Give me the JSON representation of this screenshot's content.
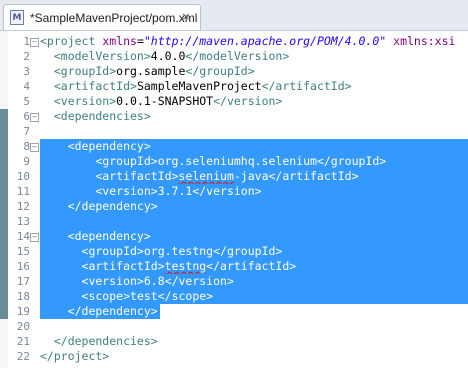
{
  "tab": {
    "title": "*SampleMavenProject/pom.xml",
    "icon": "maven-file-icon",
    "close": "×"
  },
  "colors": {
    "selection": "#3399ff",
    "tag": "#3f7f7f",
    "attr": "#7f007f",
    "string": "#2a00ff",
    "line_number": "#7a8899"
  },
  "editor": {
    "line_numbers": [
      "1",
      "2",
      "3",
      "4",
      "5",
      "6",
      "7",
      "8",
      "9",
      "10",
      "11",
      "12",
      "13",
      "14",
      "15",
      "16",
      "17",
      "18",
      "19",
      "20",
      "21",
      "22"
    ],
    "lines": [
      {
        "parts": [
          {
            "t": "<project ",
            "c": "tag"
          },
          {
            "t": "xmlns",
            "c": "attr"
          },
          {
            "t": "=",
            "c": "txt"
          },
          {
            "t": "\"http://maven.apache.org/POM/4.0.0\"",
            "c": "str"
          },
          {
            "t": " ",
            "c": "txt"
          },
          {
            "t": "xmlns:xsi",
            "c": "attr"
          }
        ]
      },
      {
        "parts": [
          {
            "t": "  <modelVersion>",
            "c": "tag"
          },
          {
            "t": "4.0.0",
            "c": "txt"
          },
          {
            "t": "</modelVersion>",
            "c": "tag"
          }
        ]
      },
      {
        "parts": [
          {
            "t": "  <groupId>",
            "c": "tag"
          },
          {
            "t": "org.sample",
            "c": "txt"
          },
          {
            "t": "</groupId>",
            "c": "tag"
          }
        ]
      },
      {
        "parts": [
          {
            "t": "  <artifactId>",
            "c": "tag"
          },
          {
            "t": "SampleMavenProject",
            "c": "txt"
          },
          {
            "t": "</artifactId>",
            "c": "tag"
          }
        ]
      },
      {
        "parts": [
          {
            "t": "  <version>",
            "c": "tag"
          },
          {
            "t": "0.0.1-SNAPSHOT",
            "c": "txt"
          },
          {
            "t": "</version>",
            "c": "tag"
          }
        ]
      },
      {
        "parts": [
          {
            "t": "  <dependencies>",
            "c": "tag"
          }
        ]
      },
      {
        "parts": [
          {
            "t": "",
            "c": "txt"
          }
        ]
      },
      {
        "parts": [
          {
            "t": "    <dependency>",
            "c": "tag"
          }
        ]
      },
      {
        "parts": [
          {
            "t": "        <groupId>",
            "c": "tag"
          },
          {
            "t": "org.seleniumhq.selenium",
            "c": "txt"
          },
          {
            "t": "</groupId>",
            "c": "tag"
          }
        ]
      },
      {
        "parts": [
          {
            "t": "        <artifactId>",
            "c": "tag"
          },
          {
            "t": "selenium",
            "c": "txt",
            "spell": true
          },
          {
            "t": "-java",
            "c": "txt"
          },
          {
            "t": "</artifactId>",
            "c": "tag"
          }
        ]
      },
      {
        "parts": [
          {
            "t": "        <version>",
            "c": "tag"
          },
          {
            "t": "3.7.1",
            "c": "txt"
          },
          {
            "t": "</version>",
            "c": "tag"
          }
        ]
      },
      {
        "parts": [
          {
            "t": "    </dependency>",
            "c": "tag"
          }
        ]
      },
      {
        "parts": [
          {
            "t": "",
            "c": "txt"
          }
        ]
      },
      {
        "parts": [
          {
            "t": "    <dependency>",
            "c": "tag"
          }
        ]
      },
      {
        "parts": [
          {
            "t": "      <groupId>",
            "c": "tag"
          },
          {
            "t": "org.testng",
            "c": "txt"
          },
          {
            "t": "</groupId>",
            "c": "tag"
          }
        ]
      },
      {
        "parts": [
          {
            "t": "      <artifactId>",
            "c": "tag"
          },
          {
            "t": "testng",
            "c": "txt",
            "spell": true
          },
          {
            "t": "</artifactId>",
            "c": "tag"
          }
        ]
      },
      {
        "parts": [
          {
            "t": "      <version>",
            "c": "tag"
          },
          {
            "t": "6.8",
            "c": "txt"
          },
          {
            "t": "</version>",
            "c": "tag"
          }
        ]
      },
      {
        "parts": [
          {
            "t": "      <scope>",
            "c": "tag"
          },
          {
            "t": "test",
            "c": "txt"
          },
          {
            "t": "</scope>",
            "c": "tag"
          }
        ]
      },
      {
        "parts": [
          {
            "t": "    </dependency>",
            "c": "tag"
          }
        ]
      },
      {
        "parts": [
          {
            "t": "",
            "c": "txt"
          }
        ]
      },
      {
        "parts": [
          {
            "t": "  </dependencies>",
            "c": "tag"
          }
        ]
      },
      {
        "parts": [
          {
            "t": "</project>",
            "c": "tag"
          }
        ]
      }
    ],
    "selected_lines": [
      8,
      9,
      10,
      11,
      12,
      13,
      14,
      15,
      16,
      17,
      18,
      19
    ],
    "fold_markers": {
      "1": "−",
      "6": "−",
      "8": "−",
      "14": "−"
    },
    "change_markers": [
      6,
      7,
      8,
      9,
      10,
      11,
      12,
      13,
      14,
      15,
      16,
      17,
      18,
      19
    ]
  }
}
